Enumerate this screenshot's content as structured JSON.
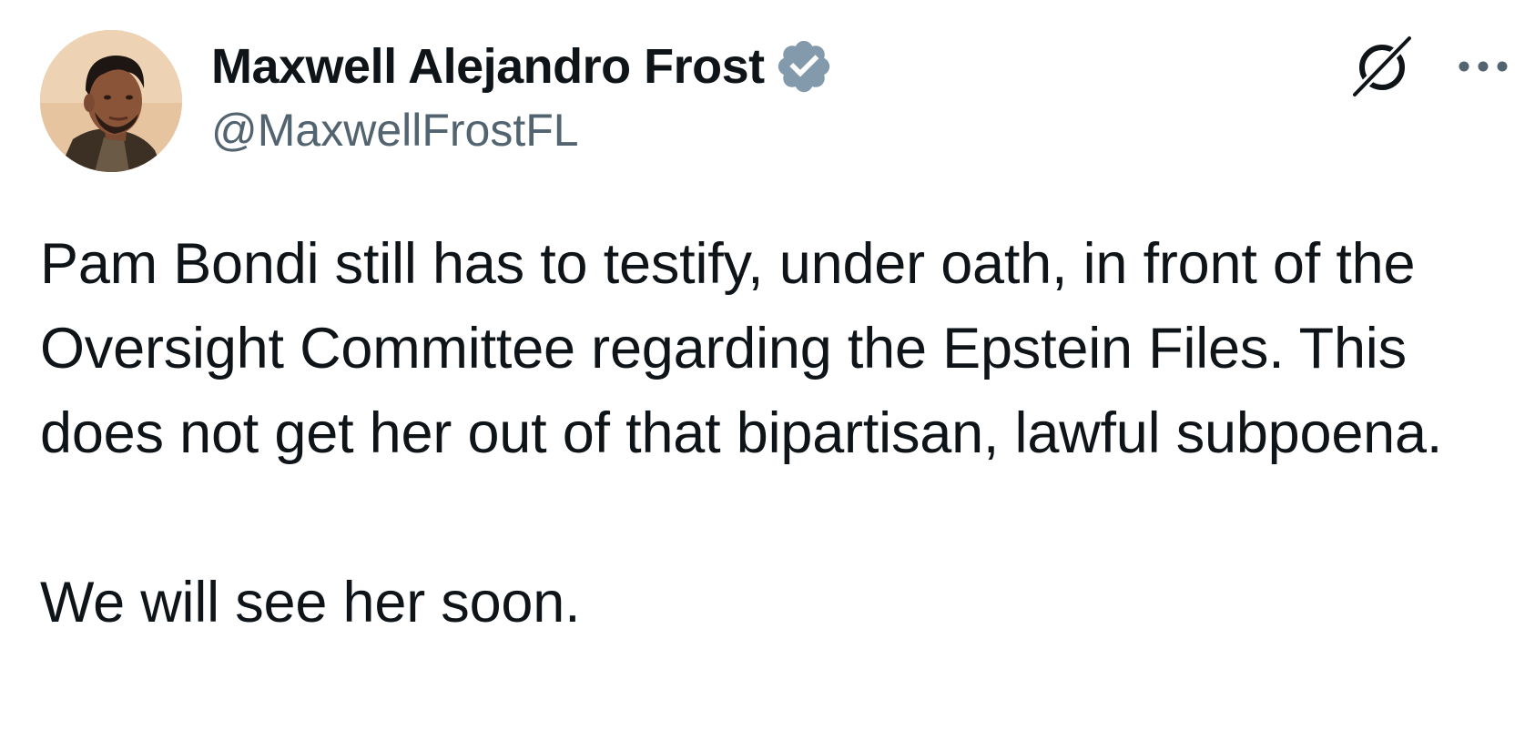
{
  "author": {
    "display_name": "Maxwell Alejandro Frost",
    "handle": "@MaxwellFrostFL",
    "verified": true,
    "verified_badge_color": "#829aab",
    "avatar_icon": "profile-photo"
  },
  "actions": {
    "grok_icon": "grok-icon",
    "more_icon": "more-options-icon"
  },
  "tweet": {
    "paragraph_1": "Pam Bondi still has to testify, under oath, in front of the Oversight Committee regarding the Epstein Files. This does not get her out of that bipartisan, lawful subpoena.",
    "paragraph_2": "We will see her soon."
  },
  "colors": {
    "text_primary": "#0f1419",
    "text_secondary": "#536471",
    "background": "#ffffff"
  }
}
